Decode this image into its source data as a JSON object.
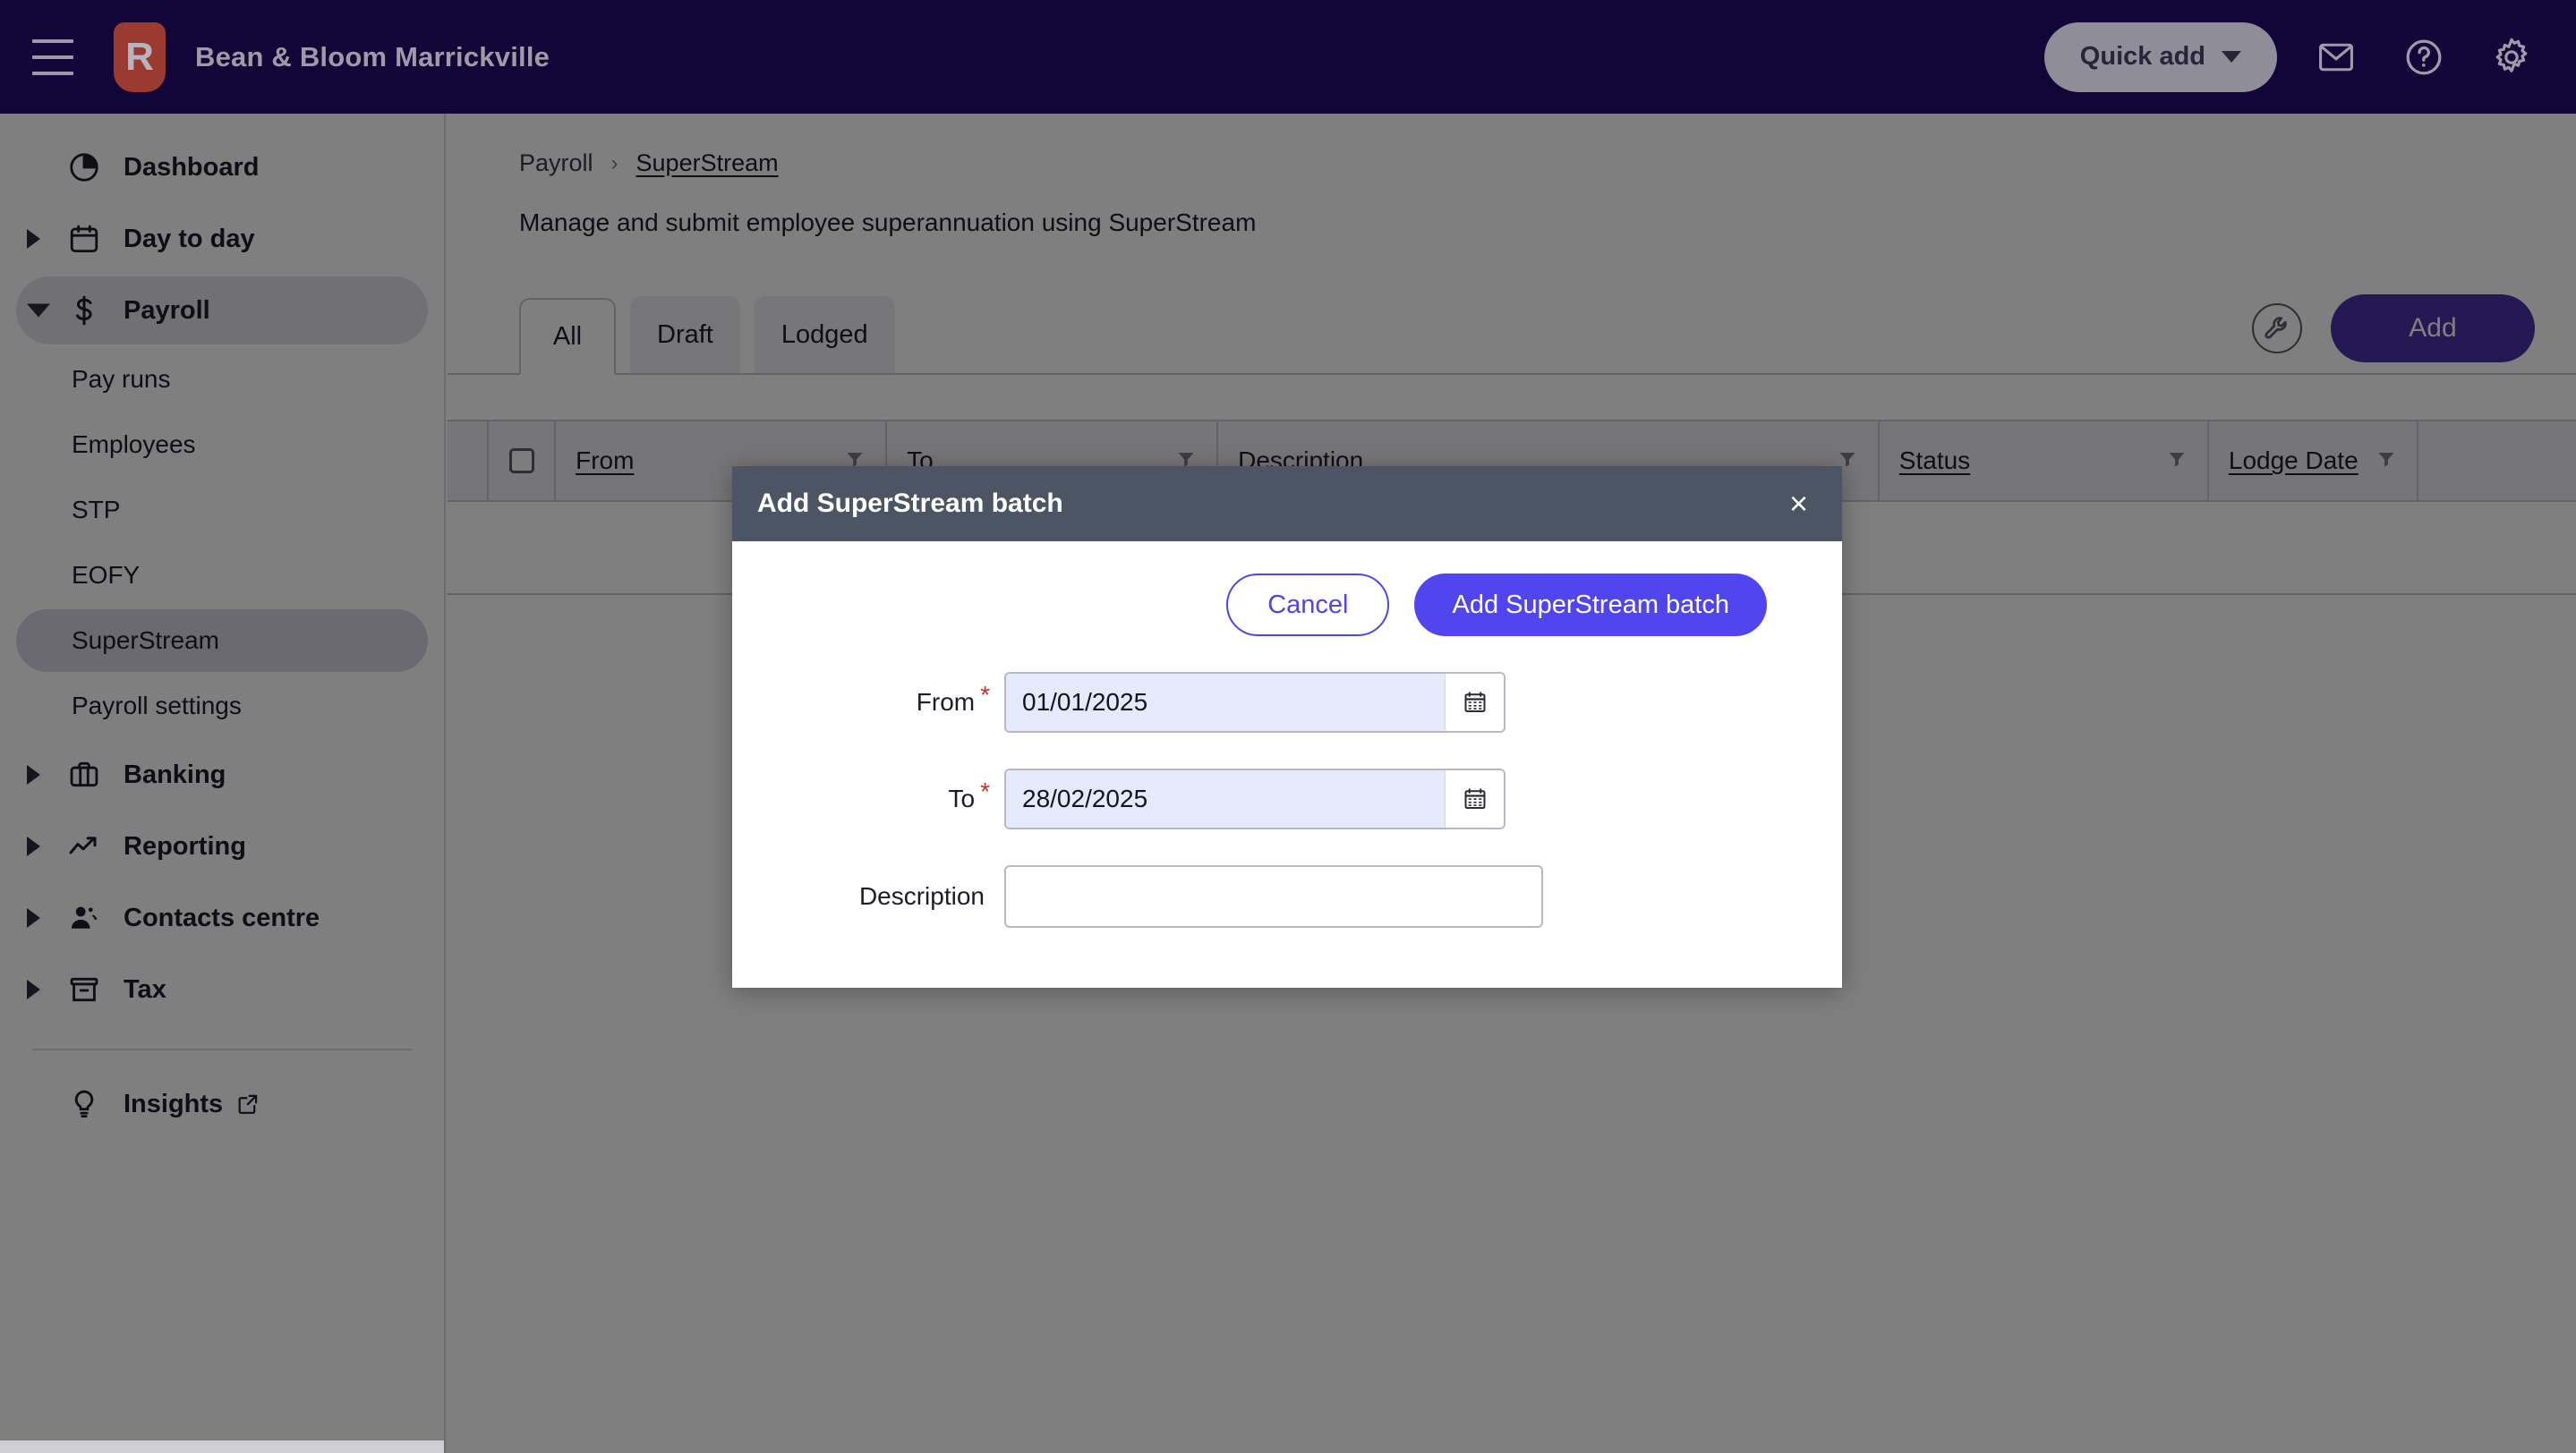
{
  "topbar": {
    "menu_icon": "hamburger-icon",
    "logo_letter": "R",
    "company_name": "Bean & Bloom Marrickville",
    "quick_add_label": "Quick add",
    "mail_icon": "mail-icon",
    "help_icon": "help-circle-icon",
    "settings_icon": "gear-icon",
    "bg_color": "#120537",
    "logo_color": "#9a3a31"
  },
  "sidebar": {
    "items": [
      {
        "label": "Dashboard",
        "icon": "pie-chart-icon",
        "caret": "none",
        "active": false
      },
      {
        "label": "Day to day",
        "icon": "calendar-icon",
        "caret": "collapsed",
        "active": false
      },
      {
        "label": "Payroll",
        "icon": "dollar-icon",
        "caret": "expanded",
        "active": true
      }
    ],
    "payroll_children": [
      {
        "label": "Pay runs",
        "active": false
      },
      {
        "label": "Employees",
        "active": false
      },
      {
        "label": "STP",
        "active": false
      },
      {
        "label": "EOFY",
        "active": false
      },
      {
        "label": "SuperStream",
        "active": true
      },
      {
        "label": "Payroll settings",
        "active": false
      }
    ],
    "items_after": [
      {
        "label": "Banking",
        "icon": "briefcase-icon",
        "caret": "collapsed",
        "active": false
      },
      {
        "label": "Reporting",
        "icon": "trending-up-icon",
        "caret": "collapsed",
        "active": false
      },
      {
        "label": "Contacts centre",
        "icon": "contacts-icon",
        "caret": "collapsed",
        "active": false
      },
      {
        "label": "Tax",
        "icon": "archive-box-icon",
        "caret": "collapsed",
        "active": false
      }
    ],
    "footer_item": {
      "label": "Insights",
      "icon": "lightbulb-icon",
      "external_icon": "external-link-icon"
    }
  },
  "breadcrumb": {
    "parent": "Payroll",
    "separator": "›",
    "current": "SuperStream"
  },
  "page": {
    "description": "Manage and submit employee superannuation using SuperStream"
  },
  "tabs": [
    {
      "label": "All",
      "active": true
    },
    {
      "label": "Draft",
      "active": false
    },
    {
      "label": "Lodged",
      "active": false
    }
  ],
  "toolbar": {
    "wrench_icon": "wrench-icon",
    "add_label": "Add",
    "add_color": "#4b32a8"
  },
  "table": {
    "select_all_checkbox": "select-all-checkbox",
    "columns": [
      {
        "label": "From",
        "filter": true
      },
      {
        "label": "To",
        "filter": true
      },
      {
        "label": "Description",
        "filter": true
      },
      {
        "label": "Status",
        "filter": true
      },
      {
        "label": "Lodge Date",
        "filter": true
      }
    ],
    "rows": []
  },
  "modal": {
    "title": "Add SuperStream batch",
    "close_label": "×",
    "header_color": "#4b5563",
    "cancel_label": "Cancel",
    "submit_label": "Add SuperStream batch",
    "submit_color": "#5045ef",
    "fields": [
      {
        "label": "From",
        "required": true,
        "value": "01/01/2025",
        "placeholder": "",
        "calendar_icon": "calendar-picker-icon"
      },
      {
        "label": "To",
        "required": true,
        "value": "28/02/2025",
        "placeholder": "",
        "calendar_icon": "calendar-picker-icon"
      },
      {
        "label": "Description",
        "required": false,
        "value": "",
        "placeholder": ""
      }
    ]
  }
}
